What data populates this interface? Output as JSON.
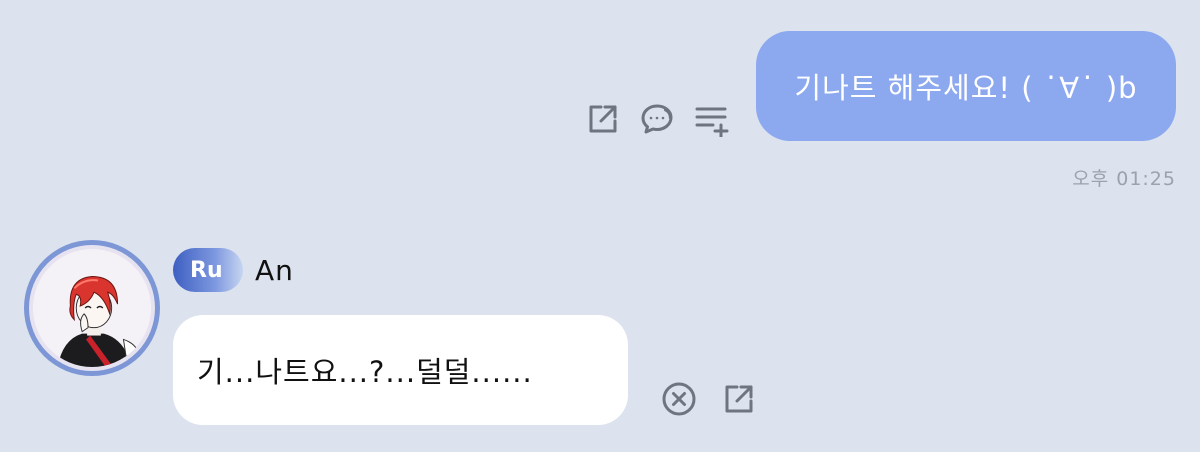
{
  "outgoing_message": {
    "text": "기나트 해주세요! ( ˙̇∀˙̇ )b",
    "time": "오후 01:25",
    "actions": [
      "share-icon",
      "reply-icon",
      "add-to-list-icon"
    ]
  },
  "incoming_message": {
    "badge": "Ru",
    "sender": "An",
    "text": "기...나트요...?...덜덜......",
    "actions": [
      "close-icon",
      "share-icon"
    ]
  },
  "colors": {
    "background": "#dce3ee",
    "outgoing_bubble": "#8ca8ef",
    "incoming_bubble": "#ffffff",
    "icon": "#6e7480",
    "timestamp": "#9aa2ad",
    "avatar_ring": "#7d97d6",
    "badge_start": "#3e5fc2"
  }
}
